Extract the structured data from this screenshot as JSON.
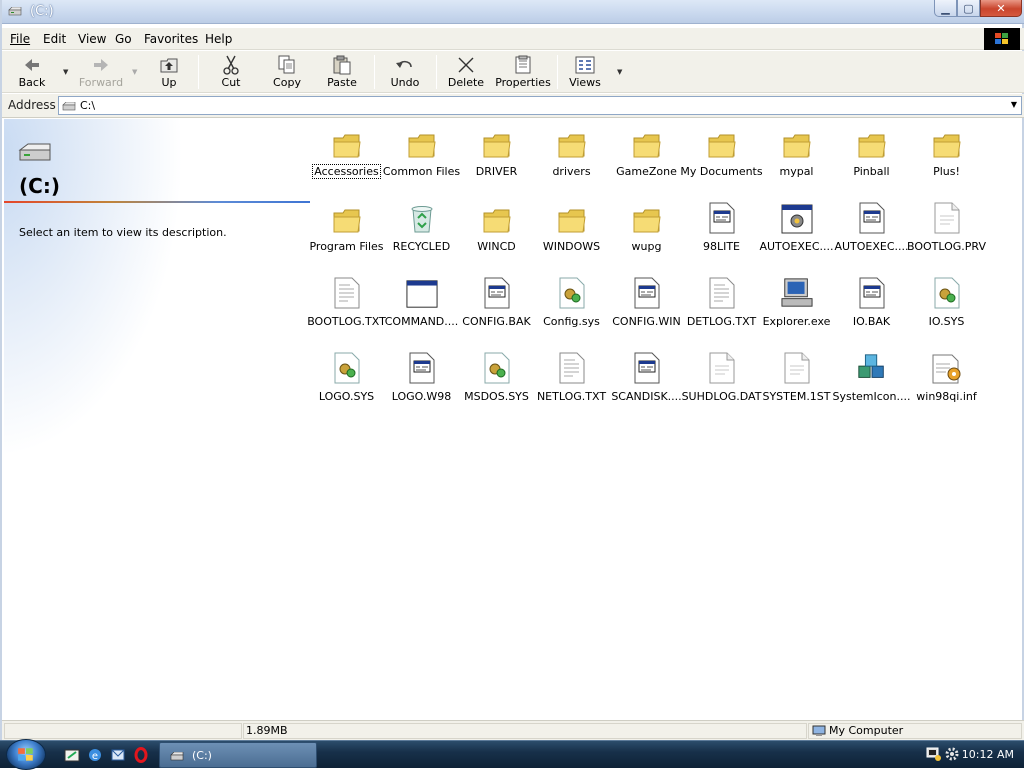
{
  "window": {
    "title": "(C:)"
  },
  "menu": [
    "File",
    "Edit",
    "View",
    "Go",
    "Favorites",
    "Help"
  ],
  "toolbar": {
    "back": "Back",
    "forward": "Forward",
    "up": "Up",
    "cut": "Cut",
    "copy": "Copy",
    "paste": "Paste",
    "undo": "Undo",
    "delete": "Delete",
    "properties": "Properties",
    "views": "Views"
  },
  "address": {
    "label": "Address",
    "value": "C:\\"
  },
  "left_pane": {
    "title": "(C:)",
    "description": "Select an item to view its description."
  },
  "items": [
    {
      "name": "Accessories",
      "icon": "folder-icon",
      "selected": true
    },
    {
      "name": "Common Files",
      "icon": "folder-icon"
    },
    {
      "name": "DRIVER",
      "icon": "folder-icon"
    },
    {
      "name": "drivers",
      "icon": "folder-icon"
    },
    {
      "name": "GameZone",
      "icon": "folder-icon"
    },
    {
      "name": "My Documents",
      "icon": "folder-icon"
    },
    {
      "name": "mypal",
      "icon": "folder-icon"
    },
    {
      "name": "Pinball",
      "icon": "folder-icon"
    },
    {
      "name": "Plus!",
      "icon": "folder-icon"
    },
    {
      "name": "Program Files",
      "icon": "folder-icon"
    },
    {
      "name": "RECYCLED",
      "icon": "recycle-bin-icon"
    },
    {
      "name": "WINCD",
      "icon": "folder-icon"
    },
    {
      "name": "WINDOWS",
      "icon": "folder-icon"
    },
    {
      "name": "wupg",
      "icon": "folder-icon"
    },
    {
      "name": "98LITE",
      "icon": "ms-dos-file-icon"
    },
    {
      "name": "AUTOEXEC....",
      "icon": "batch-file-icon"
    },
    {
      "name": "AUTOEXEC....",
      "icon": "ms-dos-file-icon"
    },
    {
      "name": "BOOTLOG.PRV",
      "icon": "generic-file-icon"
    },
    {
      "name": "BOOTLOG.TXT",
      "icon": "text-file-icon"
    },
    {
      "name": "COMMAND....",
      "icon": "application-icon"
    },
    {
      "name": "CONFIG.BAK",
      "icon": "ms-dos-file-icon"
    },
    {
      "name": "Config.sys",
      "icon": "system-file-icon"
    },
    {
      "name": "CONFIG.WIN",
      "icon": "ms-dos-file-icon"
    },
    {
      "name": "DETLOG.TXT",
      "icon": "text-file-icon"
    },
    {
      "name": "Explorer.exe",
      "icon": "computer-icon"
    },
    {
      "name": "IO.BAK",
      "icon": "ms-dos-file-icon"
    },
    {
      "name": "IO.SYS",
      "icon": "system-file-icon"
    },
    {
      "name": "LOGO.SYS",
      "icon": "system-file-icon"
    },
    {
      "name": "LOGO.W98",
      "icon": "ms-dos-file-icon"
    },
    {
      "name": "MSDOS.SYS",
      "icon": "system-file-icon"
    },
    {
      "name": "NETLOG.TXT",
      "icon": "text-file-icon"
    },
    {
      "name": "SCANDISK....",
      "icon": "ms-dos-file-icon"
    },
    {
      "name": "SUHDLOG.DAT",
      "icon": "generic-file-icon"
    },
    {
      "name": "SYSTEM.1ST",
      "icon": "generic-file-icon"
    },
    {
      "name": "SystemIcon....",
      "icon": "cubes-icon"
    },
    {
      "name": "win98qi.inf",
      "icon": "setup-info-icon"
    }
  ],
  "status": {
    "size": "1.89MB",
    "zone": "My Computer"
  },
  "taskbar": {
    "window_button": "(C:)",
    "clock": "10:12 AM"
  }
}
